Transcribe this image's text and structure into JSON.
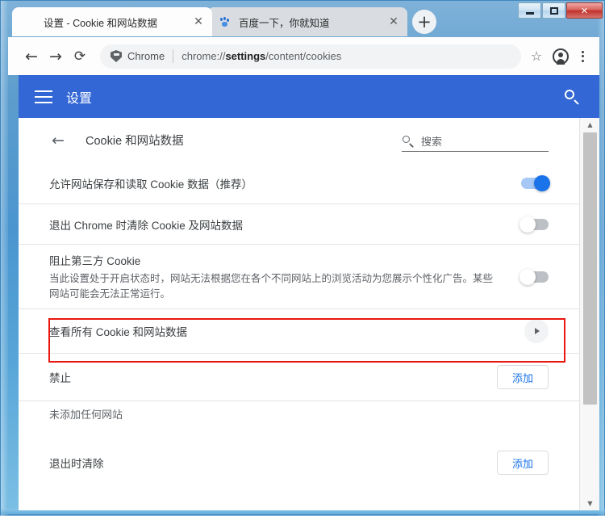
{
  "window": {
    "controls": {
      "minimize_label": "minimize",
      "restore_label": "restore",
      "close_label": "✕"
    }
  },
  "tabstrip": {
    "tabs": [
      {
        "title": "设置 - Cookie 和网站数据",
        "favicon": "gear-icon",
        "active": true,
        "close_label": "✕"
      },
      {
        "title": "百度一下，你就知道",
        "favicon": "baidu-icon",
        "active": false,
        "close_label": "✕"
      }
    ],
    "new_tab_label": "+"
  },
  "toolbar": {
    "back_label": "←",
    "forward_label": "→",
    "reload_label": "⟳",
    "security_chip": "Chrome",
    "url_prefix": "chrome://",
    "url_bold": "settings",
    "url_suffix": "/content/cookies",
    "bookmark_label": "☆"
  },
  "settings_header": {
    "title": "设置"
  },
  "subpage": {
    "back_label": "←",
    "title": "Cookie 和网站数据",
    "search_placeholder": "搜索",
    "search_value": "搜索"
  },
  "rows": [
    {
      "id": "allow-cookies",
      "title": "允许网站保存和读取 Cookie 数据（推荐）",
      "toggle": "on"
    },
    {
      "id": "clear-on-exit",
      "title": "退出 Chrome 时清除 Cookie 及网站数据",
      "toggle": "off"
    },
    {
      "id": "block-third-party",
      "title": "阻止第三方 Cookie",
      "subtitle": "当此设置处于开启状态时，网站无法根据您在各个不同网站上的浏览活动为您展示个性化广告。某些网站可能会无法正常运行。",
      "toggle": "off"
    },
    {
      "id": "see-all-cookies",
      "title": "查看所有 Cookie 和网站数据",
      "highlighted": true
    }
  ],
  "sections": [
    {
      "id": "block",
      "title": "禁止",
      "add_label": "添加",
      "empty_text": "未添加任何网站"
    },
    {
      "id": "clear-on-exit-list",
      "title": "退出时清除",
      "add_label": "添加"
    }
  ],
  "colors": {
    "chrome_blue": "#3367d6",
    "accent_blue": "#1a73e8",
    "toggle_on_track": "#a6c8f7",
    "toggle_off_track": "#bdc1c6",
    "highlight_red": "#e8170f"
  }
}
